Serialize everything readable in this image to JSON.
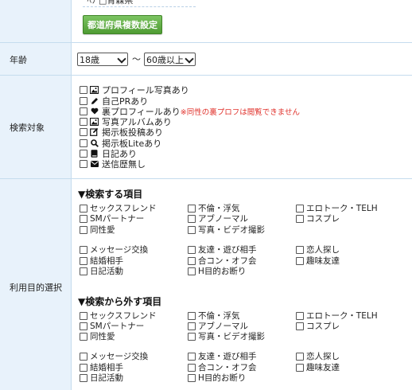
{
  "prefecture": {
    "partial_text": "ﾟﾍｿ    □青森県",
    "button_label": "都道府県複数設定"
  },
  "age": {
    "label": "年齢",
    "from_value": "18歳",
    "separator": "〜",
    "to_value": "60歳以上"
  },
  "targets": {
    "label": "検索対象",
    "items": [
      {
        "icon": "image-icon",
        "label": "プロフィール写真あり"
      },
      {
        "icon": "pencil-icon",
        "label": "自己PRあり"
      },
      {
        "icon": "heart-icon",
        "label": "裏プロフィールあり",
        "note": "※同性の裏プロフは閲覧できません"
      },
      {
        "icon": "image-icon",
        "label": "写真アルバムあり"
      },
      {
        "icon": "edit-icon",
        "label": "掲示板投稿あり"
      },
      {
        "icon": "search-icon",
        "label": "掲示板Liteあり"
      },
      {
        "icon": "book-icon",
        "label": "日記あり"
      },
      {
        "icon": "envelope-icon",
        "label": "送信歴無し"
      }
    ]
  },
  "purpose": {
    "label": "利用目的選択",
    "include_title": "▼検索する項目",
    "exclude_title": "▼検索から外す項目",
    "group1": [
      [
        "セックスフレンド",
        "不倫・浮気",
        "エロトーク・TELH"
      ],
      [
        "SMパートナー",
        "アブノーマル",
        "コスプレ"
      ],
      [
        "同性愛",
        "写真・ビデオ撮影",
        ""
      ]
    ],
    "group2": [
      [
        "メッセージ交換",
        "友達・遊び相手",
        "恋人探し"
      ],
      [
        "結婚相手",
        "合コン・オフ会",
        "趣味友達"
      ],
      [
        "日記活動",
        "H目的お断り",
        ""
      ]
    ]
  }
}
